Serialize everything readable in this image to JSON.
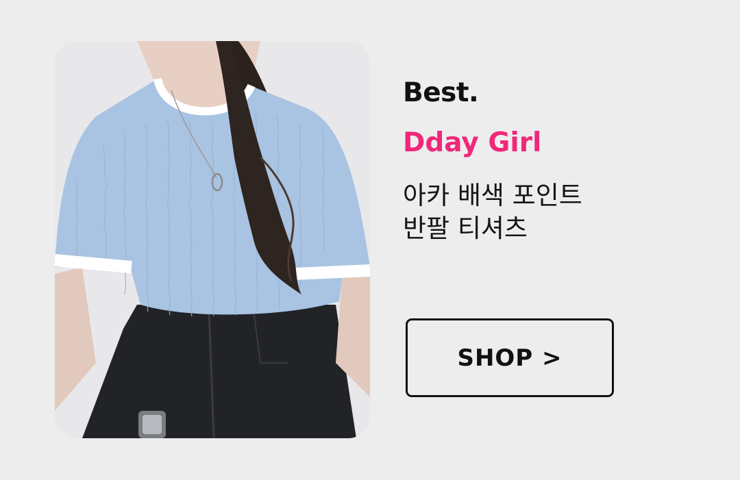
{
  "banner": {
    "label": "Best.",
    "brand": "Dday Girl",
    "title_line_1": "아카 배색 포인트",
    "title_line_2": "반팔 티셔츠",
    "cta_label": "SHOP >"
  },
  "image": {
    "subject": "product-photo",
    "shirt_color": "#a9c3e2",
    "trim_color": "#ffffff",
    "pants_color": "#1e1f22"
  },
  "colors": {
    "background": "#ededed",
    "brand_accent": "#f0287a",
    "text": "#111111"
  }
}
